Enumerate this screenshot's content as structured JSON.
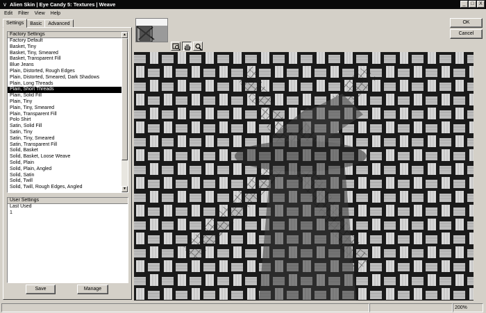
{
  "window": {
    "icon": "v",
    "title": "Alien Skin | Eye Candy 5: Textures | Weave",
    "minimize": "_",
    "maximize": "□",
    "close": "X"
  },
  "menu": [
    "Edit",
    "Filter",
    "View",
    "Help"
  ],
  "tabs": [
    "Settings",
    "Basic",
    "Advanced"
  ],
  "factory": {
    "header": "Factory Settings",
    "items": [
      "Factory Default",
      "Basket, Tiny",
      "Basket, Tiny, Smeared",
      "Basket, Transparent Fill",
      "Blue Jeans",
      "Plain, Distorted, Rough Edges",
      "Plain, Distorted, Smeared, Dark Shadows",
      "Plain, Long Threads",
      "Plain, Short Threads",
      "Plain, Solid Fill",
      "Plain, Tiny",
      "Plain, Tiny, Smeared",
      "Plain, Transparent Fill",
      "Polo Shirt",
      "Satin, Solid Fill",
      "Satin, Tiny",
      "Satin, Tiny, Smeared",
      "Satin, Transparent Fill",
      "Solid, Basket",
      "Solid, Basket, Loose Weave",
      "Solid, Plain",
      "Solid, Plain, Angled",
      "Solid, Satin",
      "Solid, Twill",
      "Solid, Twill, Rough Edges, Angled"
    ],
    "selected": "Plain, Short Threads"
  },
  "user": {
    "header": "User Settings",
    "items": [
      "Last Used",
      "1"
    ]
  },
  "buttons": {
    "save": "Save",
    "manage": "Manage",
    "ok": "OK",
    "cancel": "Cancel"
  },
  "tools": [
    "navigate-zoom-icon",
    "hand-pan-icon",
    "magnifier-icon"
  ],
  "active_tool": "hand-pan-icon",
  "status": {
    "zoom": "200%"
  }
}
